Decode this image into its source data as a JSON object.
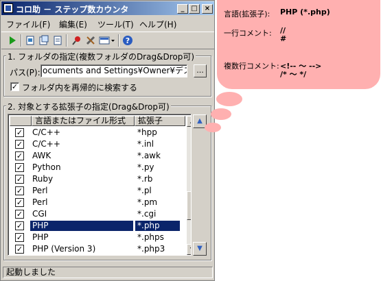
{
  "window": {
    "title": "コロ助 － ステップ数カウンタ",
    "controls": {
      "minimize": "_",
      "maximize": "□",
      "close": "×"
    }
  },
  "menu": [
    {
      "label": "ファイル(F)"
    },
    {
      "label": "編集(E)"
    },
    {
      "label": "ツール(T)"
    },
    {
      "label": "ヘルプ(H)"
    }
  ],
  "toolbar": {
    "icons": [
      "run-icon",
      "new-icon",
      "open-icon",
      "doc-icon",
      "pin-icon",
      "tools-icon",
      "option-icon",
      "help-icon"
    ]
  },
  "folder_section": {
    "title": "1. フォルダの指定(複数フォルダのDrag&Drop可)",
    "path_label": "パス(P):",
    "path_value": "ocuments and Settings¥Owner¥デスクトップ",
    "browse_label": "...",
    "recursive_label": "フォルダ内を再帰的に検索する",
    "recursive_checked": true
  },
  "ext_section": {
    "title": "2. 対象とする拡張子の指定(Drag&Drop可)",
    "columns": [
      "言語またはファイル形式",
      "拡張子"
    ],
    "rows": [
      {
        "lang": "C/C++",
        "ext": "*hpp",
        "checked": true,
        "selected": false
      },
      {
        "lang": "C/C++",
        "ext": "*.inl",
        "checked": true,
        "selected": false
      },
      {
        "lang": "AWK",
        "ext": "*.awk",
        "checked": true,
        "selected": false
      },
      {
        "lang": "Python",
        "ext": "*.py",
        "checked": true,
        "selected": false
      },
      {
        "lang": "Ruby",
        "ext": "*.rb",
        "checked": true,
        "selected": false
      },
      {
        "lang": "Perl",
        "ext": "*.pl",
        "checked": true,
        "selected": false
      },
      {
        "lang": "Perl",
        "ext": "*.pm",
        "checked": true,
        "selected": false
      },
      {
        "lang": "CGI",
        "ext": "*.cgi",
        "checked": true,
        "selected": false
      },
      {
        "lang": "PHP",
        "ext": "*.php",
        "checked": true,
        "selected": true
      },
      {
        "lang": "PHP",
        "ext": "*.phps",
        "checked": true,
        "selected": false
      },
      {
        "lang": "PHP (Version 3)",
        "ext": "*.php3",
        "checked": true,
        "selected": false
      }
    ],
    "move_up_label": "▲",
    "move_down_label": "▼"
  },
  "status": {
    "text": "起動しました"
  },
  "bubble": {
    "lang_label": "言語(拡張子):",
    "lang_value": "PHP (*.php)",
    "line_comment_label": "一行コメント:",
    "line_comment_values": [
      "//",
      "#"
    ],
    "block_comment_label": "複数行コメント:",
    "block_comment_values": [
      "<!-- ～ -->",
      "/* ～ */"
    ]
  },
  "colors": {
    "selection": "#0a246a",
    "bubble": "#ffb0b0",
    "title_bar": "#0a246a"
  }
}
